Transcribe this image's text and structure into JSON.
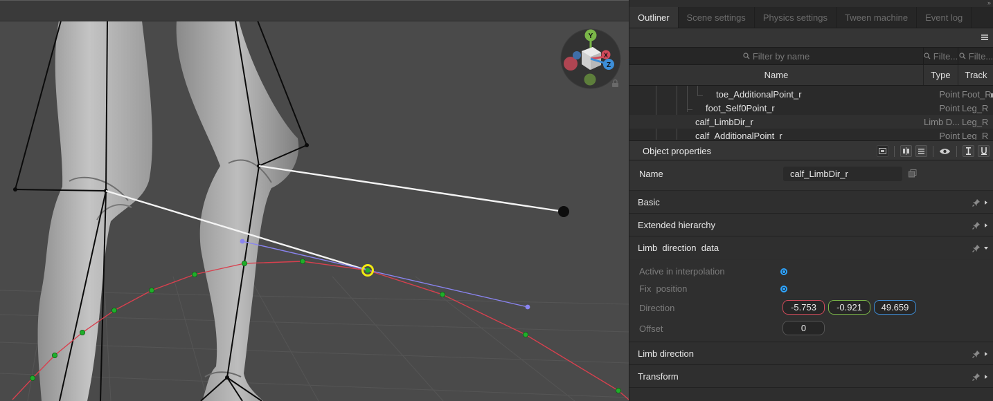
{
  "tabs": [
    {
      "label": "Outliner",
      "active": true
    },
    {
      "label": "Scene settings",
      "active": false
    },
    {
      "label": "Physics settings",
      "active": false
    },
    {
      "label": "Tween machine",
      "active": false
    },
    {
      "label": "Event log",
      "active": false
    }
  ],
  "filters": {
    "name_placeholder": "Filter by name",
    "type_placeholder": "Filte...",
    "track_placeholder": "Filte..."
  },
  "columns": {
    "name": "Name",
    "type": "Type",
    "track": "Track"
  },
  "tree": [
    {
      "name": "toe_AdditionalPoint_r",
      "type": "Point",
      "track": "Foot_R"
    },
    {
      "name": "foot_Self0Point_r",
      "type": "Point",
      "track": "Leg_R"
    },
    {
      "name": "calf_LimbDir_r",
      "type": "Limb D...",
      "track": "Leg_R"
    },
    {
      "name": "calf_AdditionalPoint_r",
      "type": "Point",
      "track": "Leg_R"
    }
  ],
  "object_properties": {
    "title": "Object properties",
    "name_label": "Name",
    "name_value": "calf_LimbDir_r",
    "sections": {
      "basic": "Basic",
      "extended": "Extended hierarchy",
      "limb_data": "Limb  direction  data",
      "limb_direction": "Limb direction",
      "transform": "Transform"
    },
    "limb_data": {
      "active_label": "Active in interpolation",
      "active": true,
      "fix_label": "Fix  position",
      "fix": true,
      "direction_label": "Direction",
      "direction_x": "-5.753",
      "direction_y": "-0.921",
      "direction_z": "49.659",
      "offset_label": "Offset",
      "offset_value": "0"
    }
  },
  "gizmo": {
    "x": "X",
    "y": "Y",
    "z": "Z"
  },
  "colors": {
    "accent": "#2fa4ff",
    "axis_x": "#d24a5a",
    "axis_y": "#7ab648",
    "axis_z": "#3d8ed8",
    "trajectory": "#d8404e",
    "keyframe": "#2aa52a",
    "tangent": "#8a84f0",
    "selected": "#f2ea10"
  }
}
